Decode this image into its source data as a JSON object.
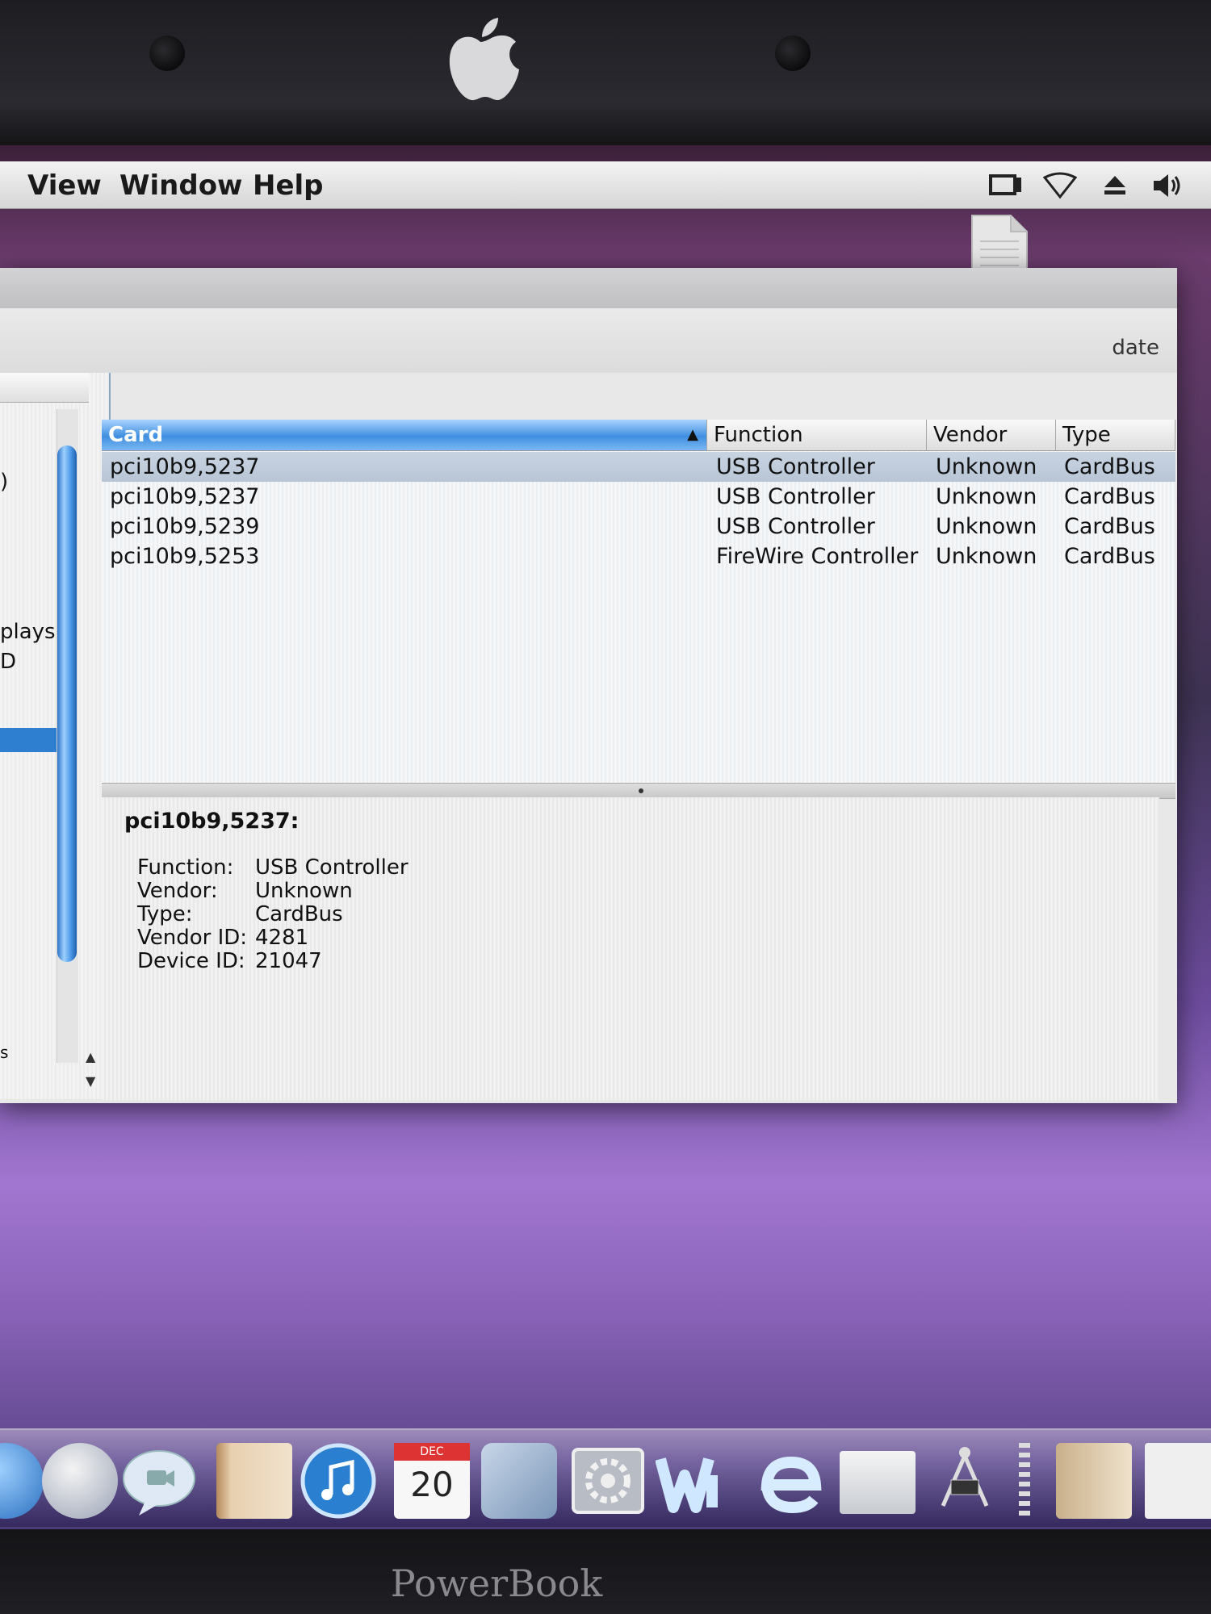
{
  "menubar": {
    "items": [
      "View",
      "Window",
      "Help"
    ]
  },
  "toolbar": {
    "label": "date"
  },
  "sidebar": {
    "fragments": [
      ")",
      "plays",
      "D",
      "s"
    ]
  },
  "table": {
    "columns": [
      "Card",
      "Function",
      "Vendor",
      "Type"
    ],
    "sorted_column": "Card",
    "rows": [
      {
        "card": "pci10b9,5237",
        "function": "USB Controller",
        "vendor": "Unknown",
        "type": "CardBus",
        "selected": true
      },
      {
        "card": "pci10b9,5237",
        "function": "USB Controller",
        "vendor": "Unknown",
        "type": "CardBus",
        "selected": false
      },
      {
        "card": "pci10b9,5239",
        "function": "USB Controller",
        "vendor": "Unknown",
        "type": "CardBus",
        "selected": false
      },
      {
        "card": "pci10b9,5253",
        "function": "FireWire Controller",
        "vendor": "Unknown",
        "type": "CardBus",
        "selected": false
      }
    ]
  },
  "detail": {
    "title": "pci10b9,5237:",
    "fields": [
      {
        "key": "Function:",
        "value": "USB Controller"
      },
      {
        "key": "Vendor:",
        "value": "Unknown"
      },
      {
        "key": "Type:",
        "value": "CardBus"
      },
      {
        "key": "Vendor ID:",
        "value": "4281"
      },
      {
        "key": "Device ID:",
        "value": "21047"
      }
    ]
  },
  "dock": {
    "calendar_day": "20",
    "calendar_month": "DEC",
    "icons": [
      "finder-icon",
      "network-globe-icon",
      "ichat-icon",
      "address-book-icon",
      "itunes-icon",
      "ical-icon",
      "iphoto-icon",
      "system-preferences-icon",
      "word-icon",
      "entourage-icon",
      "folder-icon",
      "system-profiler-icon",
      "documents-folder-icon",
      "pdf-document-icon"
    ]
  },
  "bezel": {
    "brand": "PowerBook"
  },
  "colors": {
    "selection_blue": "#2f7fd0",
    "header_sorted": "#3f8fe0",
    "row_selected": "#c2cedd"
  }
}
